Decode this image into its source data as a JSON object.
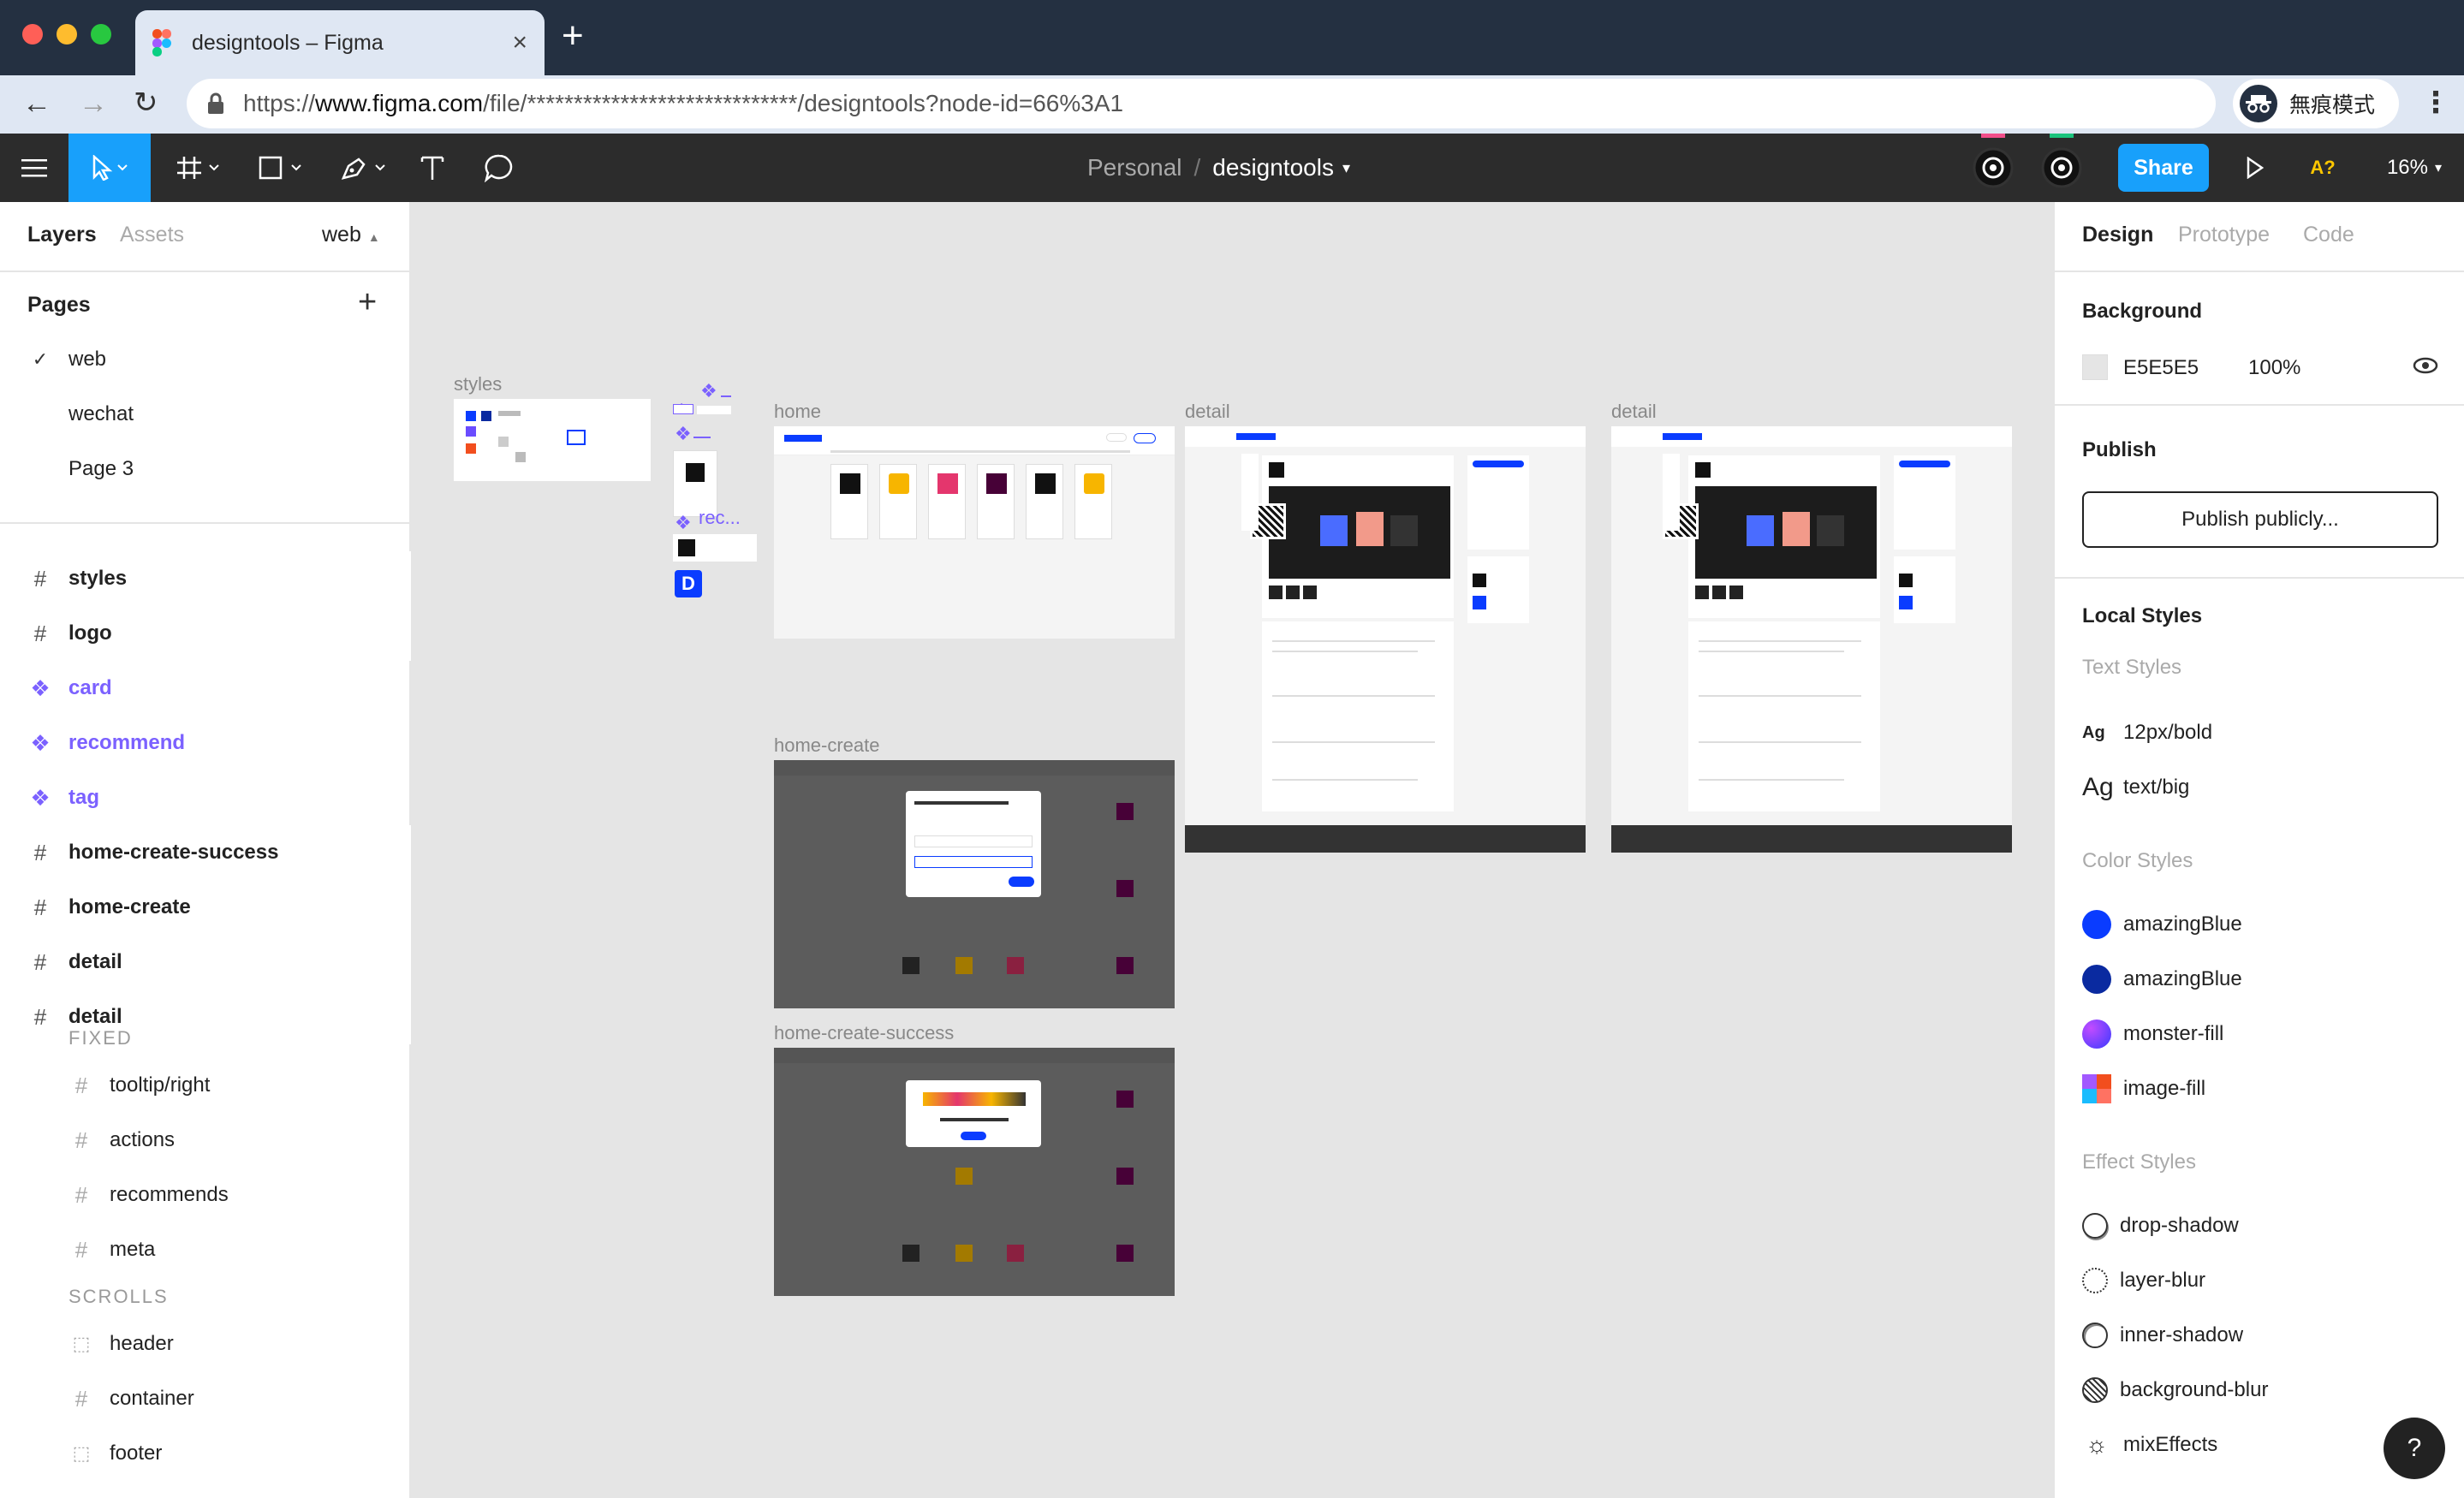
{
  "browser": {
    "tab_title": "designtools – Figma",
    "new_tab_symbol": "+",
    "close_tab_symbol": "×",
    "url_scheme": "https://",
    "url_domain": "www.figma.com",
    "url_path": "/file/*****************************/designtools?node-id=66%3A1",
    "incognito_label": "無痕模式"
  },
  "toolbar": {
    "breadcrumb_team": "Personal",
    "breadcrumb_sep": "/",
    "file_name": "designtools",
    "share_label": "Share",
    "zoom": "16%",
    "font_alert": "A?"
  },
  "left_panel": {
    "tabs": [
      "Layers",
      "Assets"
    ],
    "page_selector": "web",
    "pages_title": "Pages",
    "pages": [
      "web",
      "wechat",
      "Page 3"
    ],
    "layers": [
      {
        "label": "styles",
        "kind": "frame"
      },
      {
        "label": "logo",
        "kind": "frame"
      },
      {
        "label": "card",
        "kind": "comp"
      },
      {
        "label": "recommend",
        "kind": "comp"
      },
      {
        "label": "tag",
        "kind": "comp"
      },
      {
        "label": "home-create-success",
        "kind": "frame"
      },
      {
        "label": "home-create",
        "kind": "frame"
      },
      {
        "label": "detail",
        "kind": "frame"
      },
      {
        "label": "detail",
        "kind": "frame"
      }
    ],
    "fixed_title": "FIXED",
    "fixed_items": [
      "tooltip/right",
      "actions",
      "recommends",
      "meta"
    ],
    "scrolls_title": "SCROLLS",
    "scroll_items": [
      "header",
      "container",
      "footer"
    ]
  },
  "right_panel": {
    "tabs": [
      "Design",
      "Prototype",
      "Code"
    ],
    "background_title": "Background",
    "background_hex": "E5E5E5",
    "background_opacity": "100%",
    "publish_title": "Publish",
    "publish_button": "Publish publicly...",
    "local_styles_title": "Local Styles",
    "text_styles_title": "Text Styles",
    "text_styles": [
      {
        "sample": "Ag",
        "name": "12px/bold"
      },
      {
        "sample": "Ag",
        "name": "text/big"
      }
    ],
    "color_styles_title": "Color Styles",
    "color_styles": [
      {
        "name": "amazingBlue",
        "color": "#0a3cff"
      },
      {
        "name": "amazingBlue",
        "color": "#0a2aa0"
      },
      {
        "name": "monster-fill",
        "color": "#6a4cff"
      },
      {
        "name": "image-fill",
        "color": "#f24e1e"
      }
    ],
    "effect_styles_title": "Effect Styles",
    "effect_styles": [
      "drop-shadow",
      "layer-blur",
      "inner-shadow",
      "background-blur",
      "mixEffects"
    ],
    "help": "?"
  },
  "canvas": {
    "frames": [
      {
        "label": "styles"
      },
      {
        "label": "home"
      },
      {
        "label": "detail"
      },
      {
        "label": "detail"
      },
      {
        "label": "home-create"
      },
      {
        "label": "home-create-success"
      }
    ],
    "component_label": "rec..."
  },
  "colors": {
    "figma_blue": "#18a0fb",
    "component_purple": "#7b61ff",
    "toolbar_dark": "#2c2c2c",
    "canvas_bg": "#e5e5e5"
  }
}
